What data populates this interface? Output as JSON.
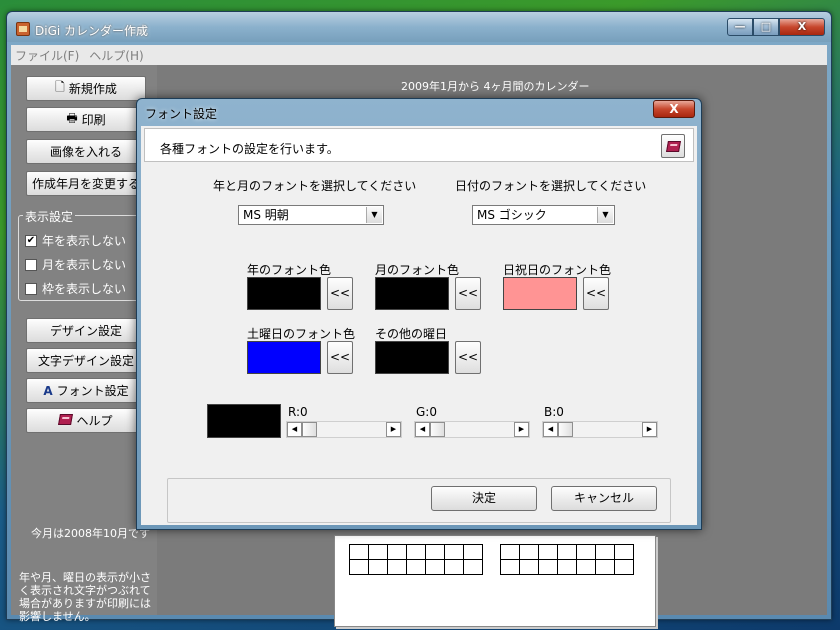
{
  "window": {
    "title": "DiGi カレンダー作成",
    "min_label": "—",
    "max_label": "□",
    "close_label": "X"
  },
  "menu": [
    "ファイル(F)",
    "ヘルプ(H)"
  ],
  "sidebar": {
    "buttons": [
      "新規作成",
      "印刷",
      "画像を入れる",
      "作成年月を変更する"
    ],
    "display_group": {
      "title": "表示設定",
      "items": [
        {
          "label": "年を表示しない",
          "checked": true
        },
        {
          "label": "月を表示しない",
          "checked": false
        },
        {
          "label": "枠を表示しない",
          "checked": false
        }
      ]
    },
    "buttons2": [
      "デザイン設定",
      "文字デザイン設定",
      "フォント設定",
      "ヘルプ"
    ],
    "current_month": "今月は2008年10月です",
    "note": "年や月、曜日の表示が小さく表示され文字がつぶれて場合がありますが印刷には影響しません。"
  },
  "main": {
    "caption": "2009年1月から 4ヶ月間のカレンダー"
  },
  "dialog": {
    "title": "フォント設定",
    "close_label": "X",
    "description": "各種フォントの設定を行います。",
    "year_month_font_label": "年と月のフォントを選択してください",
    "year_month_font_value": "MS 明朝",
    "day_font_label": "日付のフォントを選択してください",
    "day_font_value": "MS ゴシック",
    "colors": [
      {
        "label": "年のフォント色",
        "color": "#000000"
      },
      {
        "label": "月のフォント色",
        "color": "#000000"
      },
      {
        "label": "日祝日のフォント色",
        "color": "#ff9494"
      },
      {
        "label": "土曜日のフォント色",
        "color": "#0000ff"
      },
      {
        "label": "その他の曜日",
        "color": "#000000"
      }
    ],
    "apply_arrow": "<<",
    "rgb": {
      "preview_color": "#000000",
      "r_label": "R:0",
      "g_label": "G:0",
      "b_label": "B:0"
    },
    "ok_label": "決定",
    "cancel_label": "キャンセル"
  }
}
